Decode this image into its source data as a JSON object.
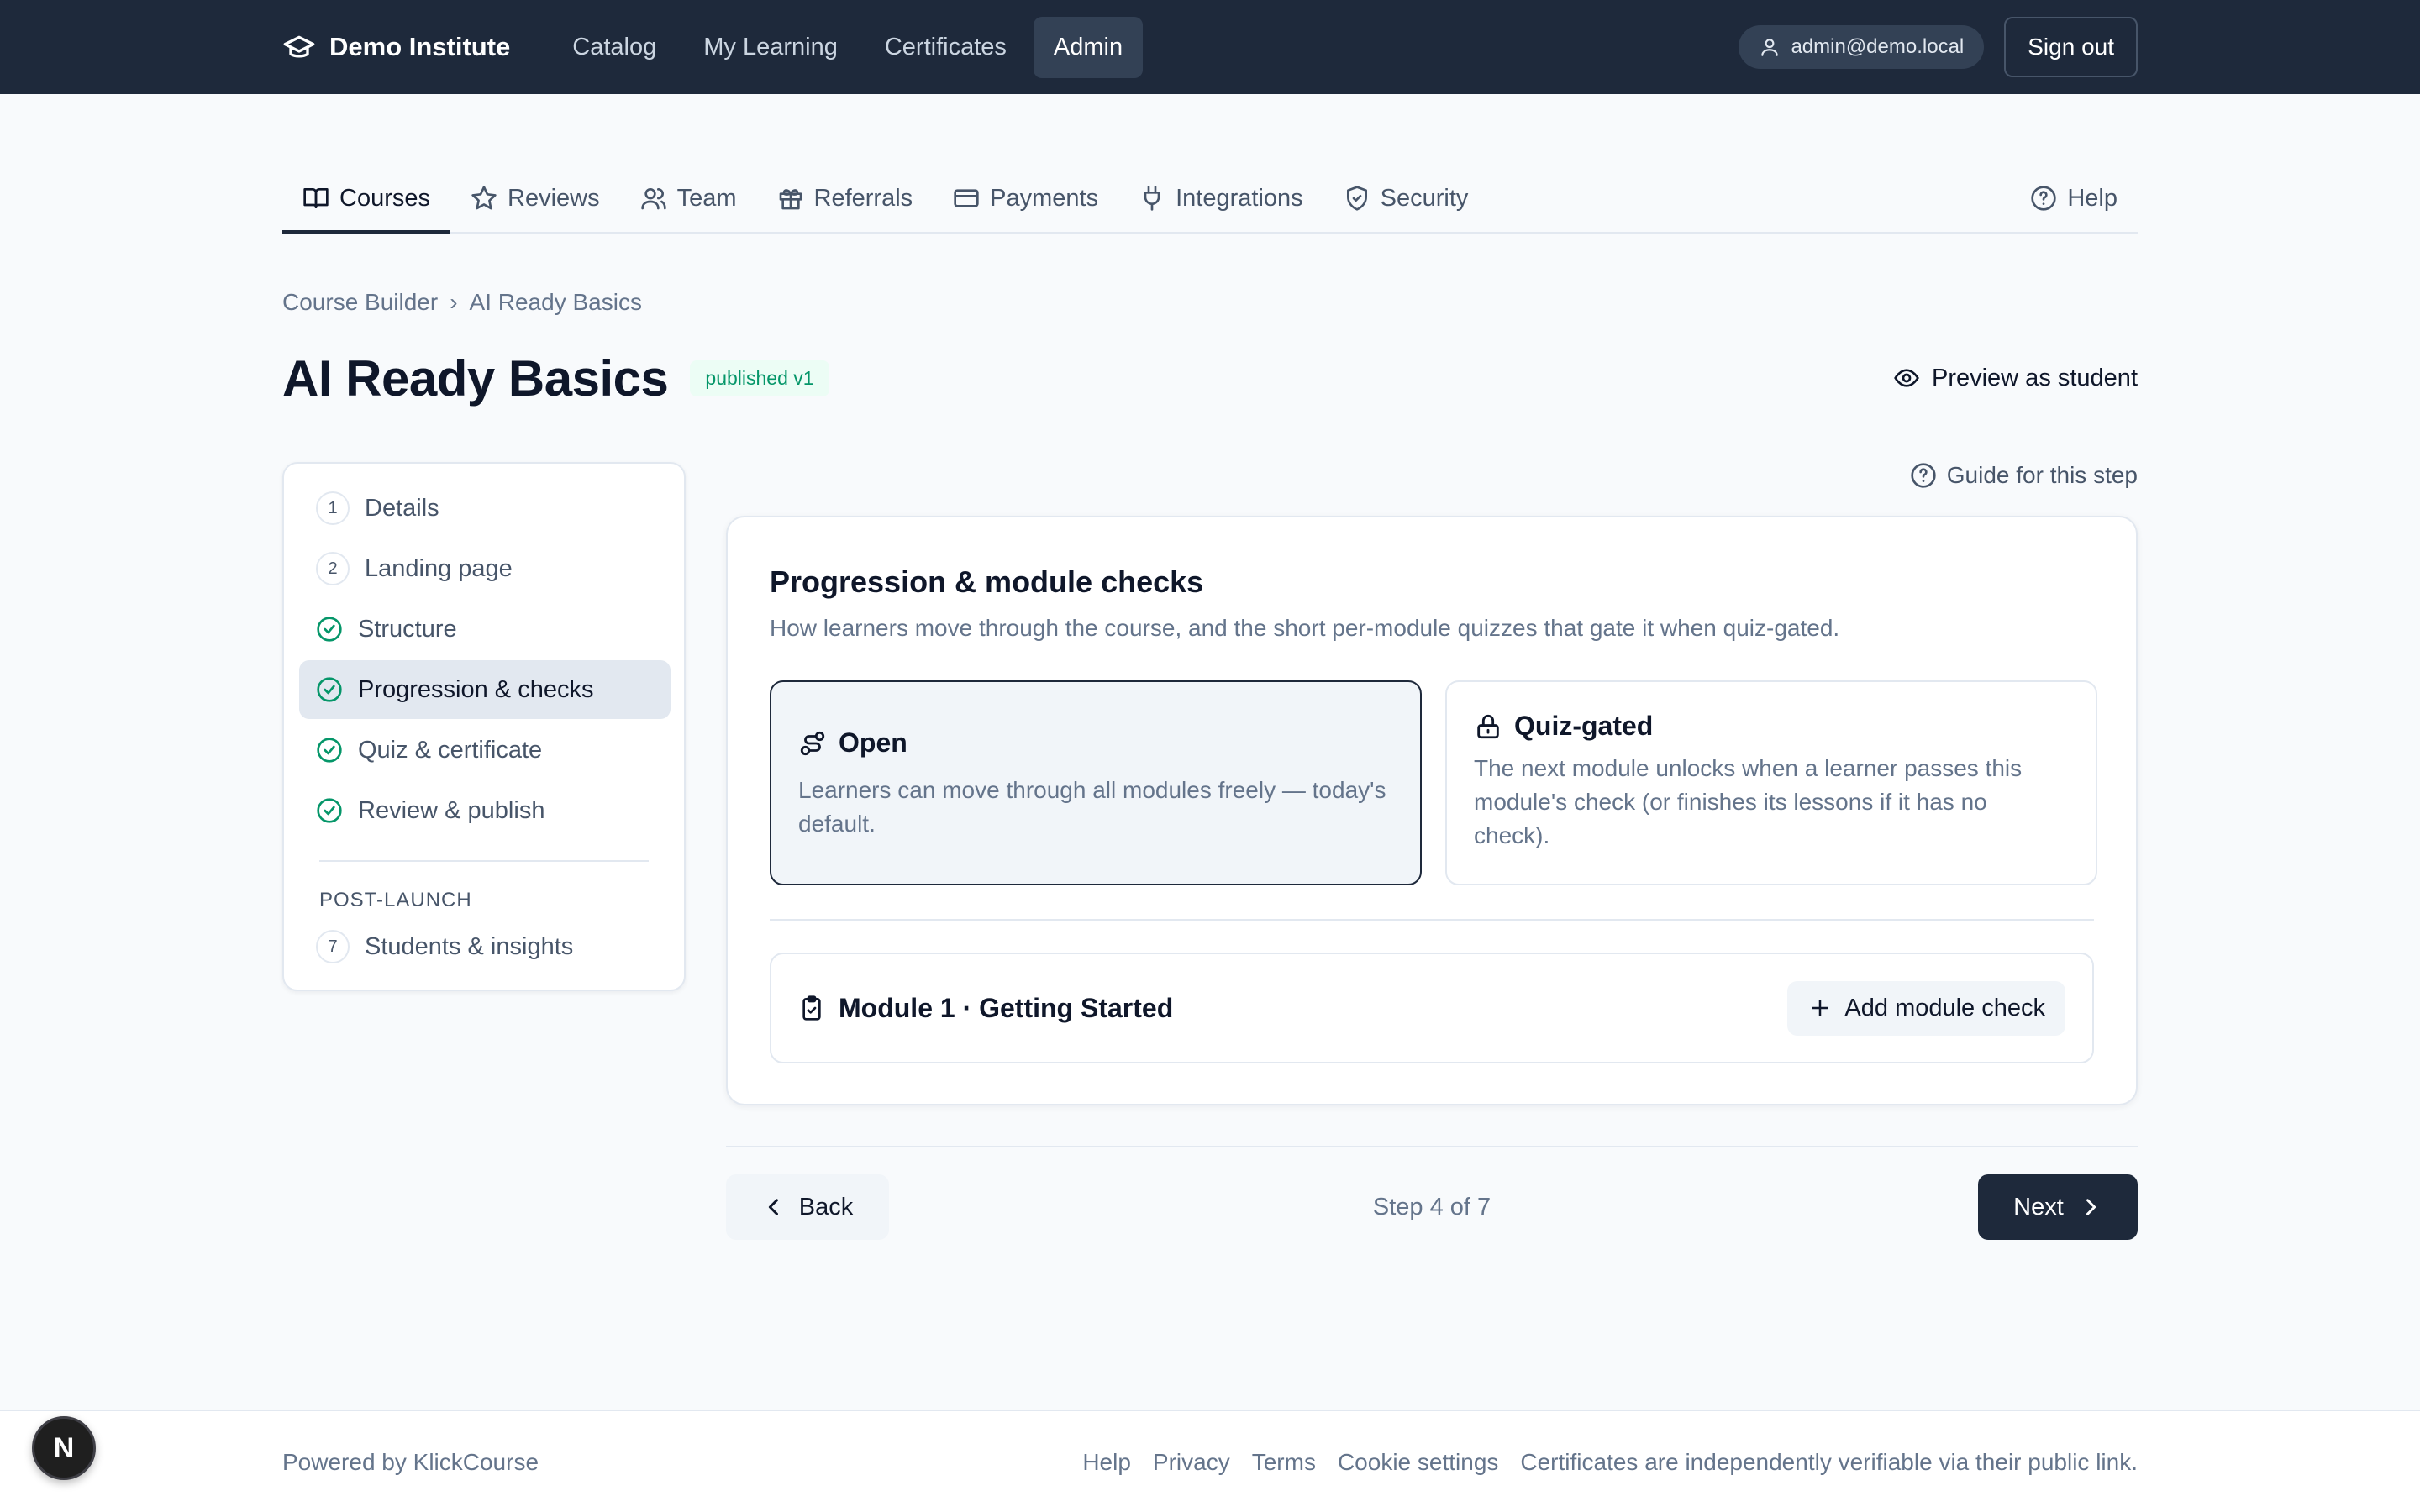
{
  "header": {
    "brand": "Demo Institute",
    "nav": [
      {
        "label": "Catalog"
      },
      {
        "label": "My Learning"
      },
      {
        "label": "Certificates"
      },
      {
        "label": "Admin",
        "active": true
      }
    ],
    "user_email": "admin@demo.local",
    "sign_out": "Sign out"
  },
  "tabs": [
    {
      "label": "Courses",
      "icon": "book-icon",
      "active": true
    },
    {
      "label": "Reviews",
      "icon": "star-icon"
    },
    {
      "label": "Team",
      "icon": "users-icon"
    },
    {
      "label": "Referrals",
      "icon": "gift-icon"
    },
    {
      "label": "Payments",
      "icon": "credit-card-icon"
    },
    {
      "label": "Integrations",
      "icon": "plug-icon"
    },
    {
      "label": "Security",
      "icon": "shield-check-icon"
    },
    {
      "label": "Help",
      "icon": "help-circle-icon"
    }
  ],
  "breadcrumb": [
    "Course Builder",
    "AI Ready Basics"
  ],
  "page": {
    "title": "AI Ready Basics",
    "status_badge": "published v1",
    "preview_label": "Preview as student"
  },
  "steps": {
    "items": [
      {
        "number": "1",
        "label": "Details",
        "state": "numbered"
      },
      {
        "number": "2",
        "label": "Landing page",
        "state": "numbered"
      },
      {
        "label": "Structure",
        "state": "done"
      },
      {
        "label": "Progression & checks",
        "state": "done",
        "active": true
      },
      {
        "label": "Quiz & certificate",
        "state": "done"
      },
      {
        "label": "Review & publish",
        "state": "done"
      }
    ],
    "section_label": "POST-LAUNCH",
    "post_launch": [
      {
        "number": "7",
        "label": "Students & insights"
      }
    ]
  },
  "guide_label": "Guide for this step",
  "card": {
    "title": "Progression & module checks",
    "description": "How learners move through the course, and the short per-module quizzes that gate it when quiz-gated.",
    "options": [
      {
        "title": "Open",
        "body": "Learners can move through all modules freely — today's default.",
        "selected": true
      },
      {
        "title": "Quiz-gated",
        "body": "The next module unlocks when a learner passes this module's check (or finishes its lessons if it has no check).",
        "selected": false
      }
    ],
    "module_title": "Module 1 · Getting Started",
    "add_check_label": "Add module check"
  },
  "wizard": {
    "back": "Back",
    "step_count": "Step 4 of 7",
    "next": "Next"
  },
  "footer": {
    "powered_by": "Powered by KlickCourse",
    "links": [
      "Help",
      "Privacy",
      "Terms",
      "Cookie settings",
      "Certificates are independently verifiable via their public link."
    ]
  },
  "fab_letter": "N",
  "colors": {
    "header_bg": "#1e293b",
    "accent_green": "#059669",
    "primary_button": "#1e293b"
  }
}
